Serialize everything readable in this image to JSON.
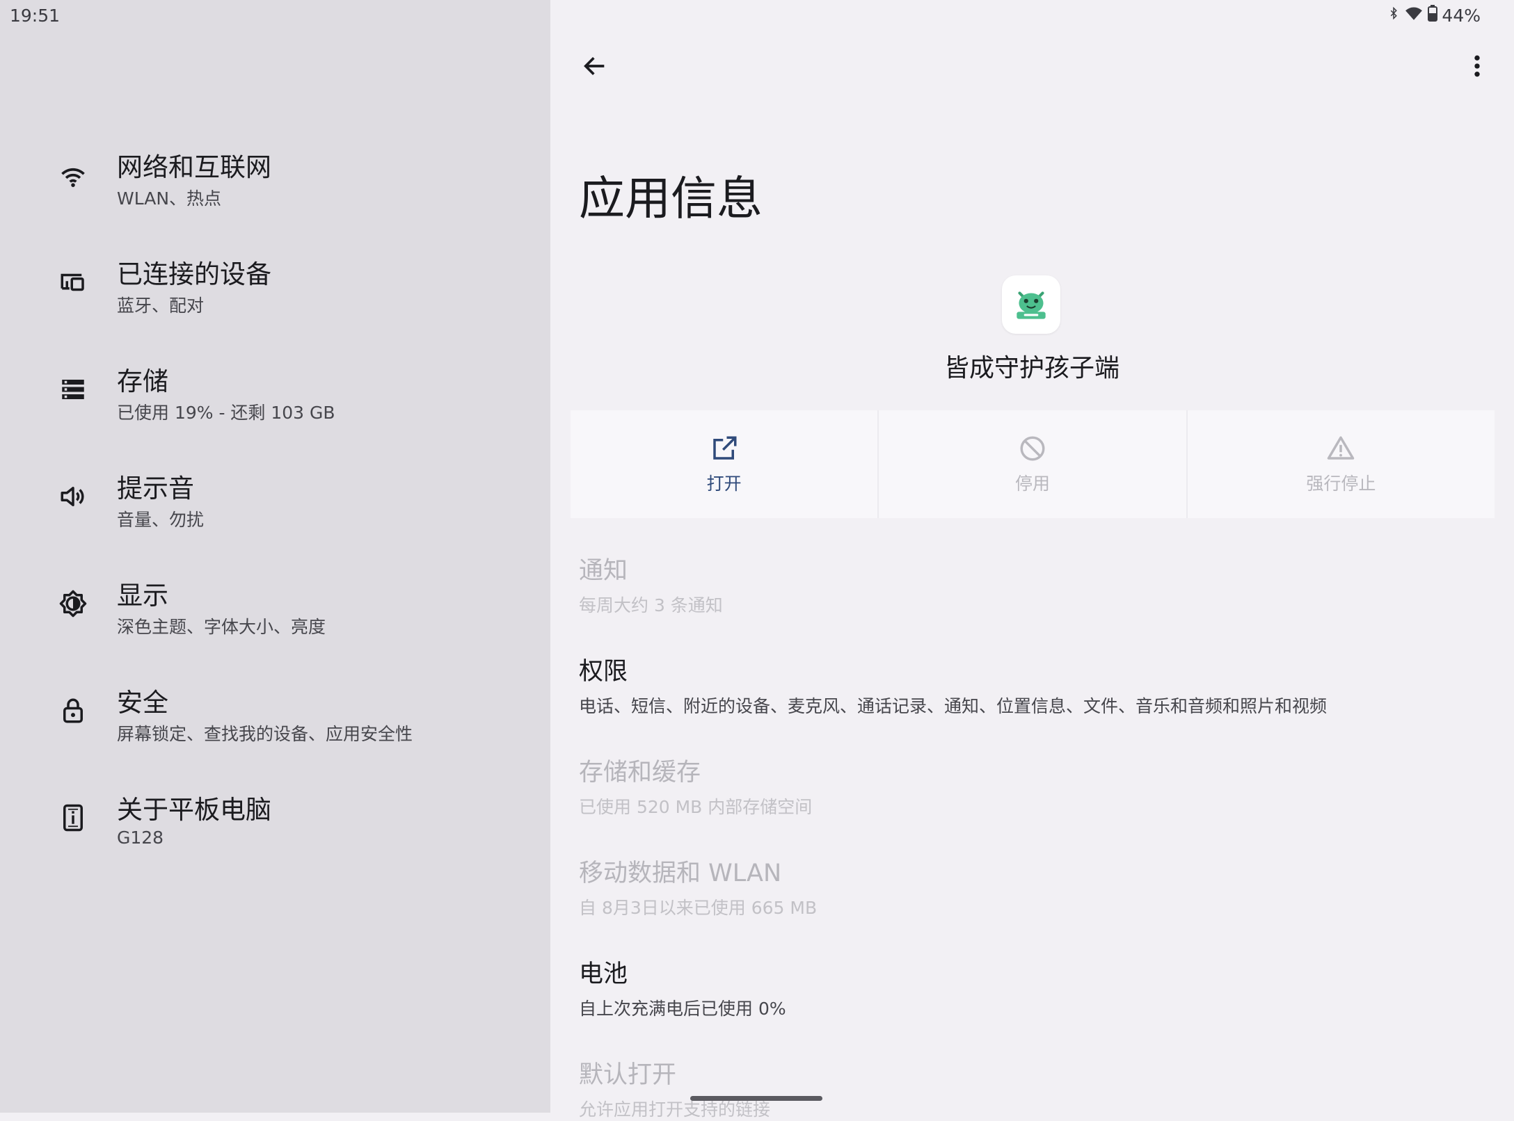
{
  "status": {
    "time": "19:51",
    "battery": "44%",
    "icons": [
      "bluetooth-icon",
      "wifi-icon",
      "battery-icon"
    ]
  },
  "sidebar": {
    "items": [
      {
        "title": "网络和互联网",
        "subtitle": "WLAN、热点",
        "icon": "wifi-icon"
      },
      {
        "title": "已连接的设备",
        "subtitle": "蓝牙、配对",
        "icon": "devices-icon"
      },
      {
        "title": "存储",
        "subtitle": "已使用 19% - 还剩 103 GB",
        "icon": "storage-icon"
      },
      {
        "title": "提示音",
        "subtitle": "音量、勿扰",
        "icon": "volume-icon"
      },
      {
        "title": "显示",
        "subtitle": "深色主题、字体大小、亮度",
        "icon": "brightness-icon"
      },
      {
        "title": "安全",
        "subtitle": "屏幕锁定、查找我的设备、应用安全性",
        "icon": "lock-icon"
      },
      {
        "title": "关于平板电脑",
        "subtitle": "G128",
        "icon": "tablet-info-icon"
      }
    ]
  },
  "main": {
    "title": "应用信息",
    "app_name": "皆成守护孩子端",
    "actions": [
      {
        "label": "打开",
        "enabled": true,
        "icon": "open-external-icon"
      },
      {
        "label": "停用",
        "enabled": false,
        "icon": "disable-icon"
      },
      {
        "label": "强行停止",
        "enabled": false,
        "icon": "warning-icon"
      }
    ],
    "settings": [
      {
        "title": "通知",
        "subtitle": "每周大约 3 条通知",
        "enabled": false
      },
      {
        "title": "权限",
        "subtitle": "电话、短信、附近的设备、麦克风、通话记录、通知、位置信息、文件、音乐和音频和照片和视频",
        "enabled": true
      },
      {
        "title": "存储和缓存",
        "subtitle": "已使用 520 MB 内部存储空间",
        "enabled": false
      },
      {
        "title": "移动数据和 WLAN",
        "subtitle": "自 8月3日以来已使用 665 MB",
        "enabled": false
      },
      {
        "title": "电池",
        "subtitle": "自上次充满电后已使用 0%",
        "enabled": true
      },
      {
        "title": "默认打开",
        "subtitle": "允许应用打开支持的链接",
        "enabled": false
      }
    ]
  },
  "colors": {
    "sidebar_bg": "#dedce1",
    "main_bg": "#f2f0f4",
    "accent": "#2f4a7a",
    "app_icon_green": "#4dbf8e"
  }
}
